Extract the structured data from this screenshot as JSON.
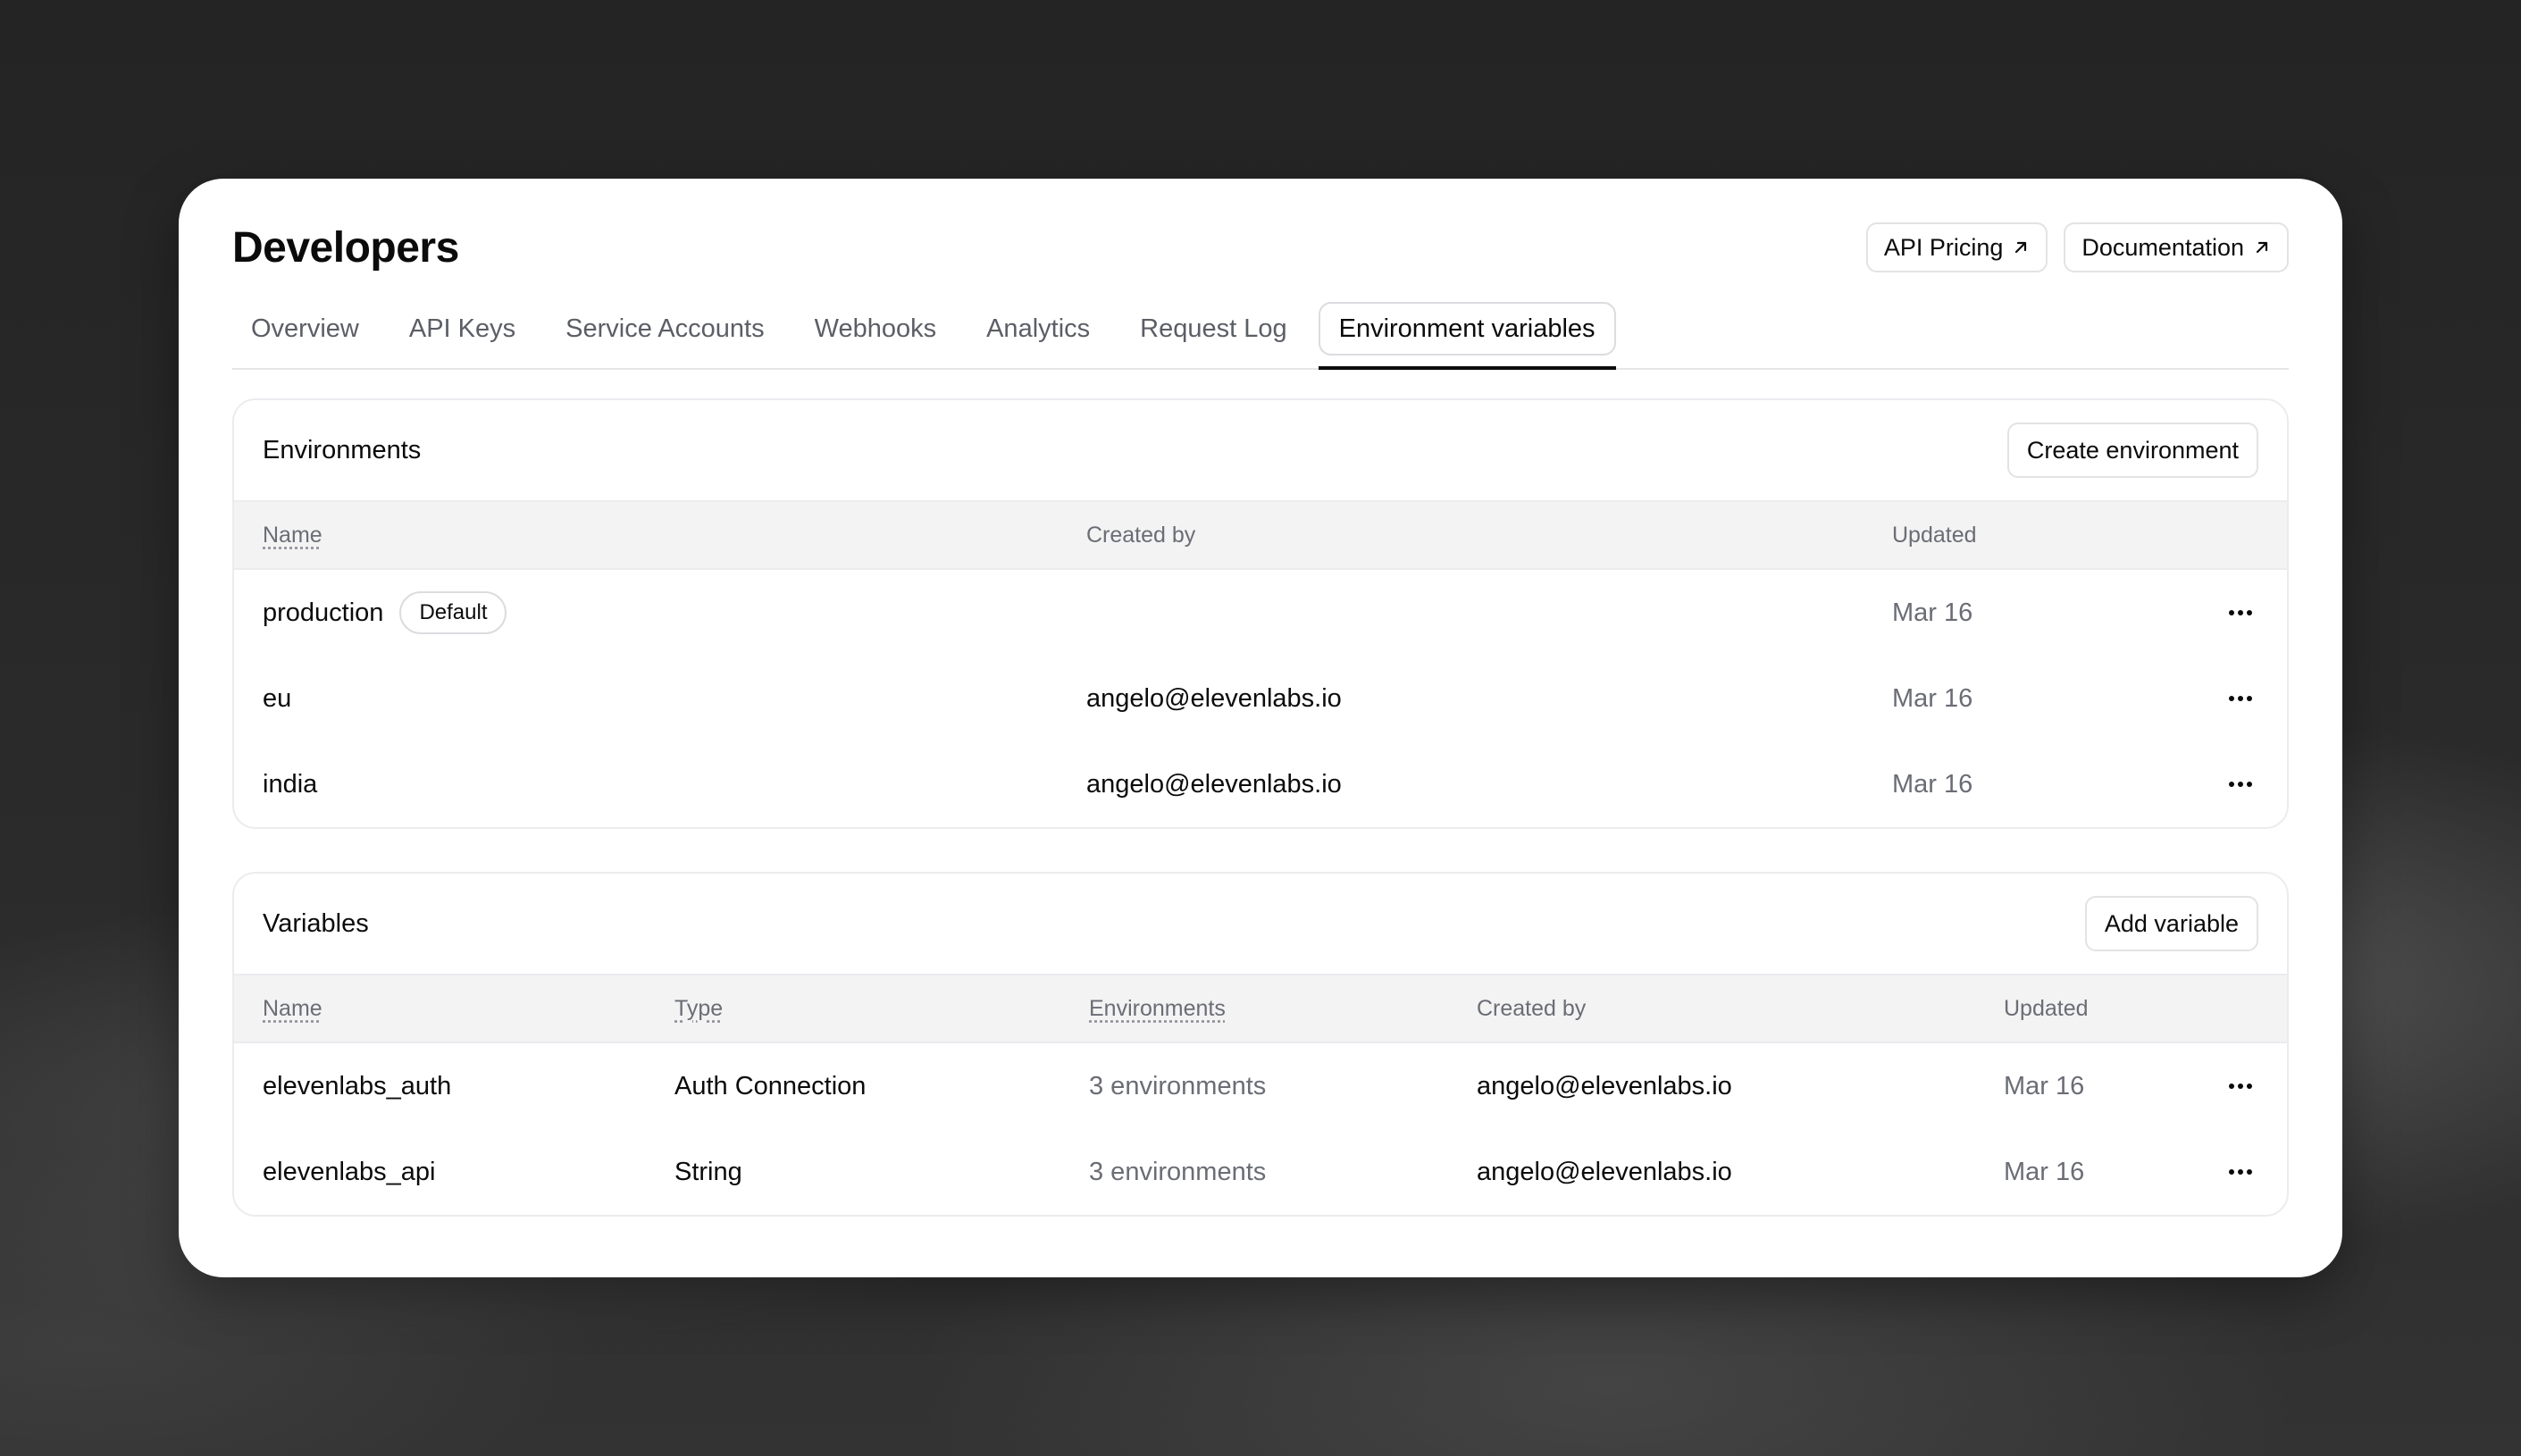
{
  "header": {
    "title": "Developers",
    "actions": [
      {
        "label": "API Pricing",
        "icon": "external-arrow-icon"
      },
      {
        "label": "Documentation",
        "icon": "external-arrow-icon"
      }
    ]
  },
  "tabs": [
    {
      "label": "Overview",
      "active": false
    },
    {
      "label": "API Keys",
      "active": false
    },
    {
      "label": "Service Accounts",
      "active": false
    },
    {
      "label": "Webhooks",
      "active": false
    },
    {
      "label": "Analytics",
      "active": false
    },
    {
      "label": "Request Log",
      "active": false
    },
    {
      "label": "Environment variables",
      "active": true
    }
  ],
  "environments": {
    "title": "Environments",
    "action_label": "Create environment",
    "columns": [
      "Name",
      "Created by",
      "Updated"
    ],
    "rows": [
      {
        "name": "production",
        "badge": "Default",
        "created_by": "",
        "updated": "Mar 16"
      },
      {
        "name": "eu",
        "badge": "",
        "created_by": "angelo@elevenlabs.io",
        "updated": "Mar 16"
      },
      {
        "name": "india",
        "badge": "",
        "created_by": "angelo@elevenlabs.io",
        "updated": "Mar 16"
      }
    ]
  },
  "variables": {
    "title": "Variables",
    "action_label": "Add variable",
    "columns": [
      "Name",
      "Type",
      "Environments",
      "Created by",
      "Updated"
    ],
    "rows": [
      {
        "name": "elevenlabs_auth",
        "type": "Auth Connection",
        "environments": "3 environments",
        "created_by": "angelo@elevenlabs.io",
        "updated": "Mar 16"
      },
      {
        "name": "elevenlabs_api",
        "type": "String",
        "environments": "3 environments",
        "created_by": "angelo@elevenlabs.io",
        "updated": "Mar 16"
      }
    ]
  }
}
